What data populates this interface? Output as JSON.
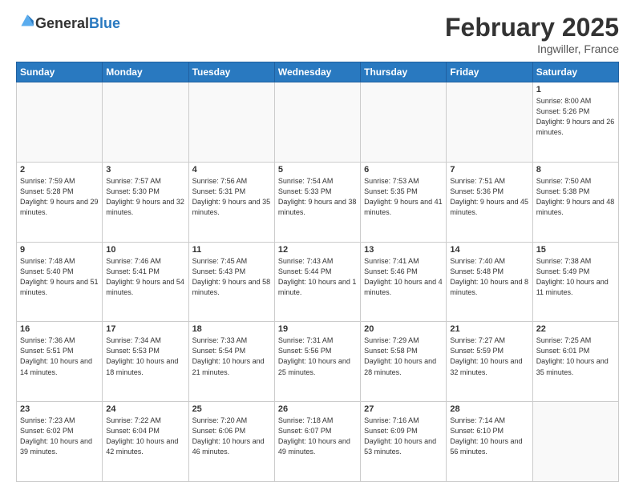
{
  "header": {
    "logo_general": "General",
    "logo_blue": "Blue",
    "month_title": "February 2025",
    "location": "Ingwiller, France"
  },
  "days_of_week": [
    "Sunday",
    "Monday",
    "Tuesday",
    "Wednesday",
    "Thursday",
    "Friday",
    "Saturday"
  ],
  "weeks": [
    [
      {
        "day": "",
        "info": ""
      },
      {
        "day": "",
        "info": ""
      },
      {
        "day": "",
        "info": ""
      },
      {
        "day": "",
        "info": ""
      },
      {
        "day": "",
        "info": ""
      },
      {
        "day": "",
        "info": ""
      },
      {
        "day": "1",
        "info": "Sunrise: 8:00 AM\nSunset: 5:26 PM\nDaylight: 9 hours and 26 minutes."
      }
    ],
    [
      {
        "day": "2",
        "info": "Sunrise: 7:59 AM\nSunset: 5:28 PM\nDaylight: 9 hours and 29 minutes."
      },
      {
        "day": "3",
        "info": "Sunrise: 7:57 AM\nSunset: 5:30 PM\nDaylight: 9 hours and 32 minutes."
      },
      {
        "day": "4",
        "info": "Sunrise: 7:56 AM\nSunset: 5:31 PM\nDaylight: 9 hours and 35 minutes."
      },
      {
        "day": "5",
        "info": "Sunrise: 7:54 AM\nSunset: 5:33 PM\nDaylight: 9 hours and 38 minutes."
      },
      {
        "day": "6",
        "info": "Sunrise: 7:53 AM\nSunset: 5:35 PM\nDaylight: 9 hours and 41 minutes."
      },
      {
        "day": "7",
        "info": "Sunrise: 7:51 AM\nSunset: 5:36 PM\nDaylight: 9 hours and 45 minutes."
      },
      {
        "day": "8",
        "info": "Sunrise: 7:50 AM\nSunset: 5:38 PM\nDaylight: 9 hours and 48 minutes."
      }
    ],
    [
      {
        "day": "9",
        "info": "Sunrise: 7:48 AM\nSunset: 5:40 PM\nDaylight: 9 hours and 51 minutes."
      },
      {
        "day": "10",
        "info": "Sunrise: 7:46 AM\nSunset: 5:41 PM\nDaylight: 9 hours and 54 minutes."
      },
      {
        "day": "11",
        "info": "Sunrise: 7:45 AM\nSunset: 5:43 PM\nDaylight: 9 hours and 58 minutes."
      },
      {
        "day": "12",
        "info": "Sunrise: 7:43 AM\nSunset: 5:44 PM\nDaylight: 10 hours and 1 minute."
      },
      {
        "day": "13",
        "info": "Sunrise: 7:41 AM\nSunset: 5:46 PM\nDaylight: 10 hours and 4 minutes."
      },
      {
        "day": "14",
        "info": "Sunrise: 7:40 AM\nSunset: 5:48 PM\nDaylight: 10 hours and 8 minutes."
      },
      {
        "day": "15",
        "info": "Sunrise: 7:38 AM\nSunset: 5:49 PM\nDaylight: 10 hours and 11 minutes."
      }
    ],
    [
      {
        "day": "16",
        "info": "Sunrise: 7:36 AM\nSunset: 5:51 PM\nDaylight: 10 hours and 14 minutes."
      },
      {
        "day": "17",
        "info": "Sunrise: 7:34 AM\nSunset: 5:53 PM\nDaylight: 10 hours and 18 minutes."
      },
      {
        "day": "18",
        "info": "Sunrise: 7:33 AM\nSunset: 5:54 PM\nDaylight: 10 hours and 21 minutes."
      },
      {
        "day": "19",
        "info": "Sunrise: 7:31 AM\nSunset: 5:56 PM\nDaylight: 10 hours and 25 minutes."
      },
      {
        "day": "20",
        "info": "Sunrise: 7:29 AM\nSunset: 5:58 PM\nDaylight: 10 hours and 28 minutes."
      },
      {
        "day": "21",
        "info": "Sunrise: 7:27 AM\nSunset: 5:59 PM\nDaylight: 10 hours and 32 minutes."
      },
      {
        "day": "22",
        "info": "Sunrise: 7:25 AM\nSunset: 6:01 PM\nDaylight: 10 hours and 35 minutes."
      }
    ],
    [
      {
        "day": "23",
        "info": "Sunrise: 7:23 AM\nSunset: 6:02 PM\nDaylight: 10 hours and 39 minutes."
      },
      {
        "day": "24",
        "info": "Sunrise: 7:22 AM\nSunset: 6:04 PM\nDaylight: 10 hours and 42 minutes."
      },
      {
        "day": "25",
        "info": "Sunrise: 7:20 AM\nSunset: 6:06 PM\nDaylight: 10 hours and 46 minutes."
      },
      {
        "day": "26",
        "info": "Sunrise: 7:18 AM\nSunset: 6:07 PM\nDaylight: 10 hours and 49 minutes."
      },
      {
        "day": "27",
        "info": "Sunrise: 7:16 AM\nSunset: 6:09 PM\nDaylight: 10 hours and 53 minutes."
      },
      {
        "day": "28",
        "info": "Sunrise: 7:14 AM\nSunset: 6:10 PM\nDaylight: 10 hours and 56 minutes."
      },
      {
        "day": "",
        "info": ""
      }
    ]
  ]
}
